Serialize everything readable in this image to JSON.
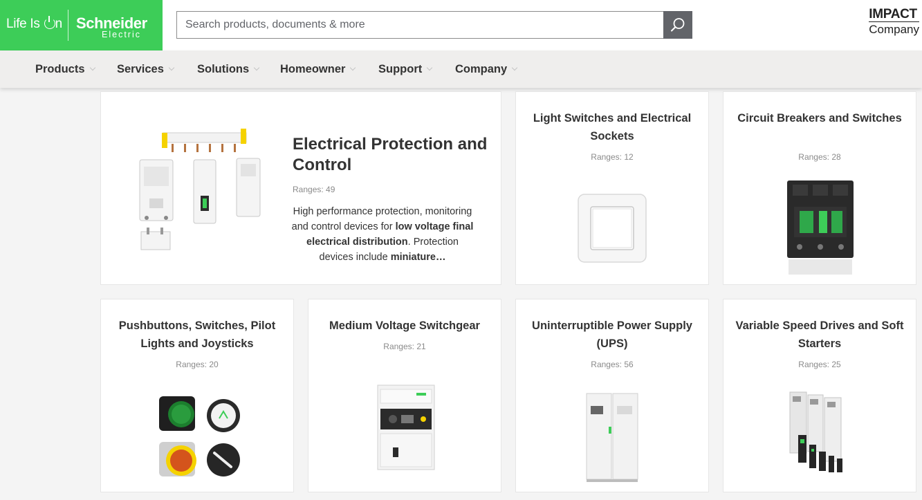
{
  "brand": {
    "tagline": "Life Is On",
    "wordmark": "Schneider",
    "submark": "Electric",
    "green": "#3dcd58"
  },
  "search": {
    "placeholder": "Search products, documents & more",
    "icon": "search-icon"
  },
  "impact": {
    "line1": "IMPACT",
    "line2": "Company"
  },
  "nav": {
    "items": [
      {
        "label": "Products"
      },
      {
        "label": "Services"
      },
      {
        "label": "Solutions"
      },
      {
        "label": "Homeowner"
      },
      {
        "label": "Support"
      },
      {
        "label": "Company"
      }
    ]
  },
  "featured": {
    "title": "Electrical Protection and Control",
    "ranges": "Ranges: 49",
    "desc_1": "High performance protection, monitoring and control devices for ",
    "desc_b1": "low voltage final electrical distribution",
    "desc_2": ". Protection devices include ",
    "desc_b2": "miniature…"
  },
  "categories": [
    {
      "title": "Light Switches and Electrical Sockets",
      "ranges": "Ranges: 12"
    },
    {
      "title": "Circuit Breakers and Switches",
      "ranges": "Ranges: 28"
    },
    {
      "title": "Pushbuttons, Switches, Pilot Lights and Joysticks",
      "ranges": "Ranges: 20"
    },
    {
      "title": "Medium Voltage Switchgear",
      "ranges": "Ranges: 21"
    },
    {
      "title": "Uninterruptible Power Supply (UPS)",
      "ranges": "Ranges: 56"
    },
    {
      "title": "Variable Speed Drives and Soft Starters",
      "ranges": "Ranges: 25"
    }
  ]
}
